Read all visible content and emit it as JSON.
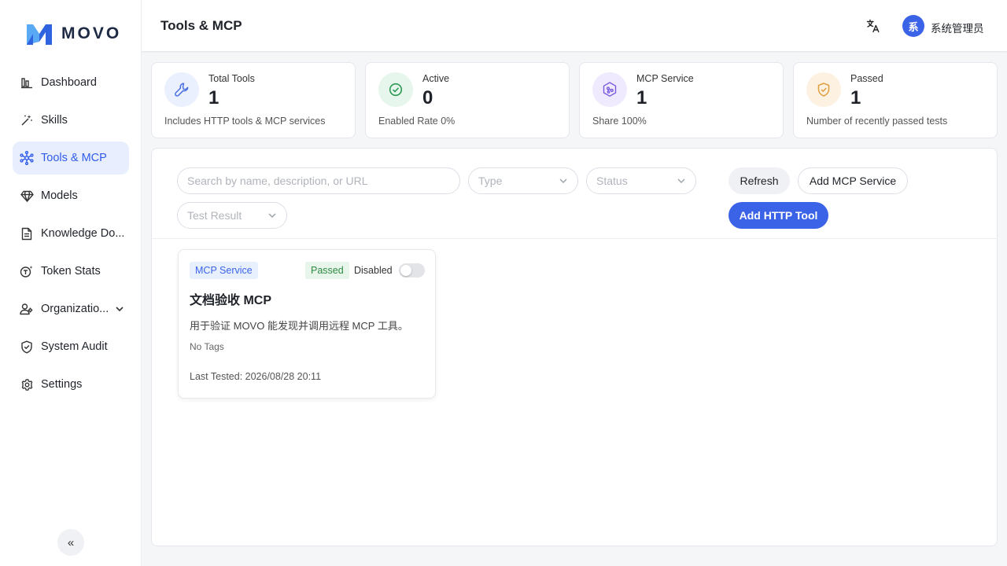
{
  "brand": {
    "name": "MOVO",
    "colors": {
      "accent": "#3b63e8",
      "logo_light": "#5aa9f5",
      "logo_dark": "#2f63e0"
    }
  },
  "sidebar": {
    "items": [
      {
        "label": "Dashboard",
        "icon": "bar-chart-icon",
        "active": false
      },
      {
        "label": "Skills",
        "icon": "magic-wand-icon",
        "active": false
      },
      {
        "label": "Tools & MCP",
        "icon": "network-icon",
        "active": true
      },
      {
        "label": "Models",
        "icon": "gem-icon",
        "active": false
      },
      {
        "label": "Knowledge Do...",
        "icon": "document-icon",
        "active": false
      },
      {
        "label": "Token Stats",
        "icon": "token-icon",
        "active": false
      },
      {
        "label": "Organizatio...",
        "icon": "users-icon",
        "active": false,
        "expandable": true
      },
      {
        "label": "System Audit",
        "icon": "shield-check-icon",
        "active": false
      },
      {
        "label": "Settings",
        "icon": "gear-icon",
        "active": false
      }
    ],
    "collapse_label": "«"
  },
  "header": {
    "title": "Tools & MCP",
    "language_icon": "translate-icon",
    "user": {
      "avatar_text": "系",
      "name": "系统管理员"
    }
  },
  "stats": [
    {
      "label": "Total Tools",
      "value": "1",
      "sub": "Includes HTTP tools & MCP services",
      "icon": "wrench-icon",
      "color": "#4a6fe0",
      "bg": "#eaf0fd"
    },
    {
      "label": "Active",
      "value": "0",
      "sub": "Enabled Rate 0%",
      "icon": "check-circle-icon",
      "color": "#2e9a55",
      "bg": "#e6f6ec"
    },
    {
      "label": "MCP Service",
      "value": "1",
      "sub": "Share 100%",
      "icon": "mcp-hub-icon",
      "color": "#7b5ce0",
      "bg": "#efeafd"
    },
    {
      "label": "Passed",
      "value": "1",
      "sub": "Number of recently passed tests",
      "icon": "shield-check-icon",
      "color": "#e0a040",
      "bg": "#fdf1e2"
    }
  ],
  "filters": {
    "search_placeholder": "Search by name, description, or URL",
    "type_placeholder": "Type",
    "status_placeholder": "Status",
    "test_result_placeholder": "Test Result"
  },
  "actions": {
    "refresh": "Refresh",
    "add_mcp": "Add MCP Service",
    "add_http": "Add HTTP Tool"
  },
  "tools": [
    {
      "type": "MCP Service",
      "test_status": "Passed",
      "toggle_label": "Disabled",
      "enabled": false,
      "name": "文档验收 MCP",
      "description": "用于验证 MOVO 能发现并调用远程 MCP 工具。",
      "tags": "No Tags",
      "last_tested": "Last Tested: 2026/08/28 20:11"
    }
  ]
}
